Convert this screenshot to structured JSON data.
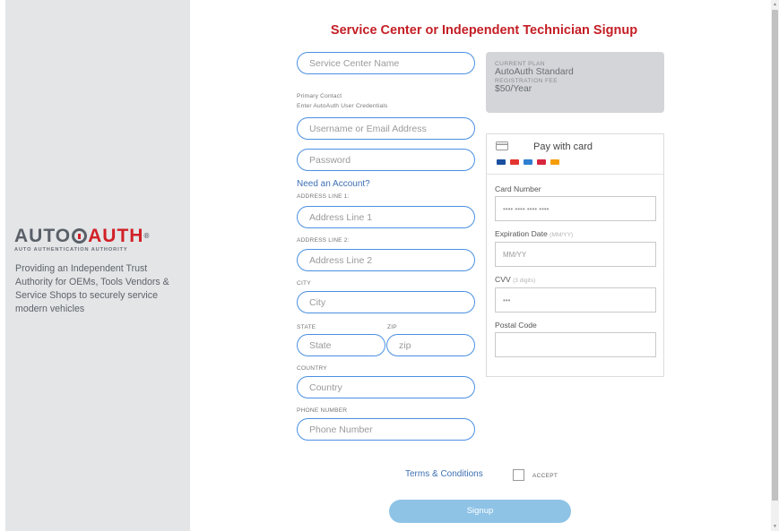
{
  "brand": {
    "logo_auto": "AUTO",
    "logo_auth": "AUTH",
    "logo_tm": "®",
    "logo_sub": "AUTO AUTHENTICATION AUTHORITY",
    "tagline": "Providing an Independent Trust Authority for OEMs, Tools Vendors & Service Shops to securely service modern vehicles"
  },
  "form": {
    "title": "Service Center or Independent Technician Signup",
    "service_center_placeholder": "Service Center Name",
    "primary_contact_label": "Primary Contact",
    "primary_contact_hint": "Enter AutoAuth User Credentials",
    "username_placeholder": "Username or Email Address",
    "password_placeholder": "Password",
    "need_account": "Need an Account?",
    "address1_label": "ADDRESS LINE 1:",
    "address1_placeholder": "Address Line 1",
    "address2_label": "ADDRESS LINE 2:",
    "address2_placeholder": "Address Line 2",
    "city_label": "CITY",
    "city_placeholder": "City",
    "state_label": "STATE",
    "state_placeholder": "State",
    "zip_label": "ZIP",
    "zip_placeholder": "zip",
    "country_label": "COUNTRY",
    "country_placeholder": "Country",
    "phone_label": "PHONE NUMBER",
    "phone_placeholder": "Phone Number",
    "terms_link": "Terms & Conditions",
    "accept_label": "ACCEPT",
    "signup_button": "Signup"
  },
  "plan": {
    "current_plan_label": "CURRENT PLAN",
    "current_plan_value": "AutoAuth Standard",
    "registration_fee_label": "REGISTRATION FEE",
    "registration_fee_value": "$50/Year"
  },
  "payment": {
    "pay_with_card": "Pay with card",
    "card_icon": "credit-card-icon",
    "card_number_label": "Card Number",
    "card_number_placeholder": "•••• •••• •••• ••••",
    "expiration_label": "Expiration Date",
    "expiration_hint": "(MM/YY)",
    "expiration_placeholder": "MM/YY",
    "cvv_label": "CVV",
    "cvv_hint": "(3 digits)",
    "cvv_placeholder": "•••",
    "postal_label": "Postal Code",
    "brand_colors": [
      "#1a4fa0",
      "#e3342f",
      "#2f7fd1",
      "#d7263d",
      "#f59e0b"
    ]
  },
  "colors": {
    "accent_red": "#c41e25",
    "link_blue": "#3d6fb3",
    "input_border": "#4a90e2",
    "signup_bg": "#8ec3e6"
  }
}
